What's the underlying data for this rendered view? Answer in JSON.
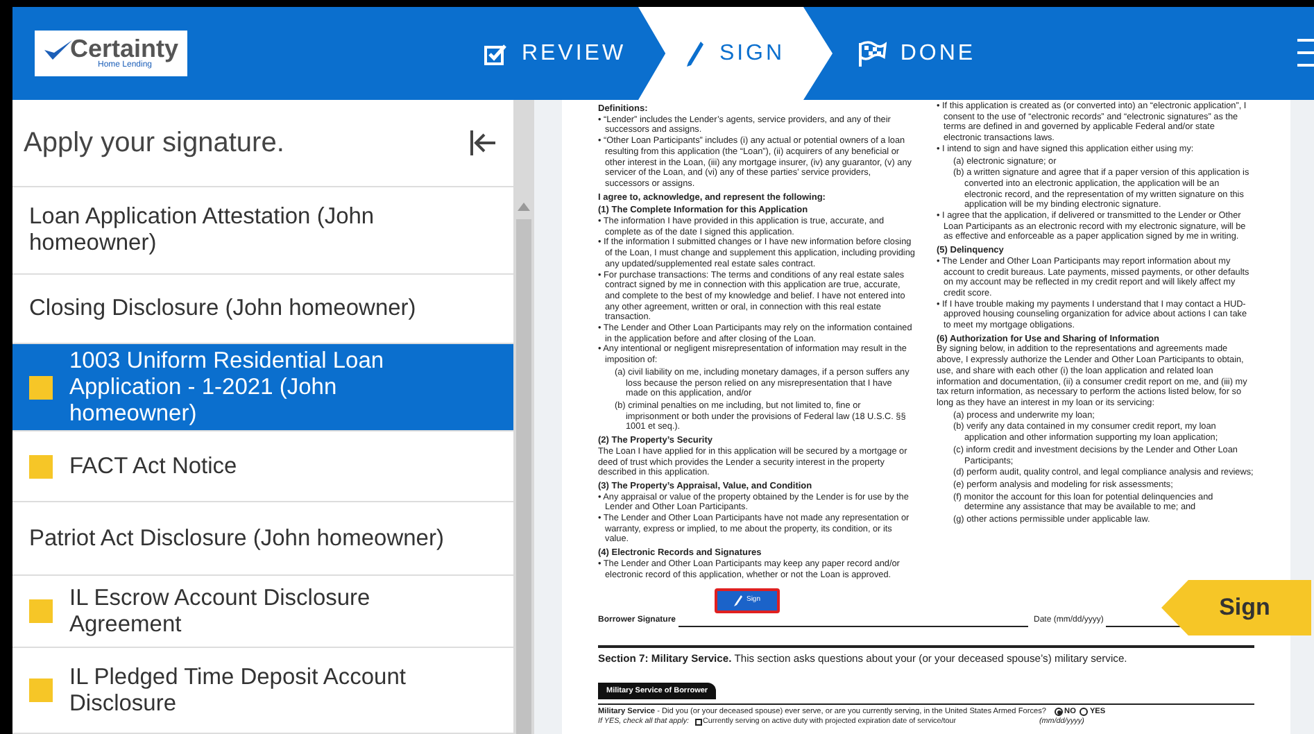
{
  "header": {
    "logo": {
      "name": "Certainty",
      "tagline": "Home Lending"
    },
    "steps": [
      {
        "label": "REVIEW",
        "selected": false
      },
      {
        "label": "SIGN",
        "selected": true
      },
      {
        "label": "DONE",
        "selected": false
      }
    ]
  },
  "sidebar": {
    "title": "Apply your signature.",
    "items": [
      {
        "label": "Loan Application Attestation (John homeowner)",
        "selected": false,
        "needs_signature": false
      },
      {
        "label": "Closing Disclosure (John homeowner)",
        "selected": false,
        "needs_signature": false
      },
      {
        "label": "1003 Uniform Residential Loan Application - 1-2021 (John homeowner)",
        "selected": true,
        "needs_signature": true
      },
      {
        "label": "FACT Act Notice",
        "selected": false,
        "needs_signature": true
      },
      {
        "label": "Patriot Act Disclosure (John homeowner)",
        "selected": false,
        "needs_signature": false
      },
      {
        "label": "IL Escrow Account Disclosure Agreement",
        "selected": false,
        "needs_signature": true
      },
      {
        "label": "IL Pledged Time Deposit Account Disclosure",
        "selected": false,
        "needs_signature": true
      }
    ]
  },
  "document": {
    "left_column": [
      {
        "kind": "heading",
        "text": "Definitions:"
      },
      {
        "kind": "bullet",
        "text": "• “Lender” includes the Lender’s agents, service providers, and any of their successors and assigns."
      },
      {
        "kind": "bullet",
        "text": "• “Other Loan Participants” includes (i) any actual or potential owners of a loan resulting from this application (the “Loan”), (ii) acquirers of any beneficial or other interest in the Loan, (iii) any mortgage insurer, (iv) any guarantor, (v) any servicer of the Loan, and (vi) any of these parties’ service providers, successors or assigns."
      },
      {
        "kind": "heading",
        "text": "I agree to, acknowledge, and represent the following:"
      },
      {
        "kind": "heading",
        "text": "(1) The Complete Information for this Application"
      },
      {
        "kind": "bullet",
        "text": "• The information I have provided in this application is true, accurate, and complete as of the date I signed this application."
      },
      {
        "kind": "bullet",
        "text": "• If the information I submitted changes or I have new information before closing of the Loan, I must change and supplement this application, including providing any updated/supplemented real estate sales contract."
      },
      {
        "kind": "bullet",
        "text": "• For purchase transactions: The terms and conditions of any real estate sales contract signed by me in connection with this application are true, accurate, and complete to the best of my knowledge and belief. I have not entered into any other agreement, written or oral, in connection with this real estate transaction."
      },
      {
        "kind": "bullet",
        "text": "• The Lender and Other Loan Participants may rely on the information contained in the application before and after closing of the Loan."
      },
      {
        "kind": "bullet",
        "text": "• Any intentional or negligent misrepresentation of information may result in the imposition of:"
      },
      {
        "kind": "sub",
        "text": "(a) civil liability on me, including monetary damages, if a person suffers any loss because the person relied on any misrepresentation that I have made on this application, and/or"
      },
      {
        "kind": "sub",
        "text": "(b) criminal penalties on me including, but not limited to, fine or imprisonment or both under the provisions of Federal law (18 U.S.C. §§ 1001 et seq.)."
      },
      {
        "kind": "heading",
        "text": "(2) The Property’s Security"
      },
      {
        "kind": "para",
        "text": "The Loan I have applied for in this application will be secured by a mortgage or deed of trust which provides the Lender a security interest in the property described in this application."
      },
      {
        "kind": "heading",
        "text": "(3) The Property’s Appraisal, Value, and Condition"
      },
      {
        "kind": "bullet",
        "text": "• Any appraisal or value of the property obtained by the Lender is for use by the Lender and Other Loan Participants."
      },
      {
        "kind": "bullet",
        "text": "• The Lender and Other Loan Participants have not made any representation or warranty, express or implied, to me about the property, its condition, or its value."
      },
      {
        "kind": "heading",
        "text": "(4) Electronic Records and Signatures"
      },
      {
        "kind": "bullet",
        "text": "• The Lender and Other Loan Participants may keep any paper record and/or electronic record of this application, whether or not the Loan is approved."
      }
    ],
    "right_column": [
      {
        "kind": "bullet",
        "text": "• If this application is created as (or converted into) an “electronic application”, I consent to the use of “electronic records” and “electronic signatures” as the terms are defined in and governed by applicable Federal and/or state electronic transactions laws."
      },
      {
        "kind": "bullet",
        "text": "• I intend to sign and have signed this application either using my:"
      },
      {
        "kind": "sub",
        "text": "(a) electronic signature; or"
      },
      {
        "kind": "sub",
        "text": "(b) a written signature and agree that if a paper version of this application is converted into an electronic application, the application will be an electronic record, and the representation of my written signature on this application will be my binding electronic signature."
      },
      {
        "kind": "bullet",
        "text": "• I agree that the application, if delivered or transmitted to the Lender or Other Loan Participants as an electronic record with my electronic signature, will be as effective and enforceable as a paper application signed by me in writing."
      },
      {
        "kind": "heading",
        "text": "(5) Delinquency"
      },
      {
        "kind": "bullet",
        "text": "• The Lender and Other Loan Participants may report information about my account to credit bureaus. Late payments, missed payments, or other defaults on my account may be reflected in my credit report and will likely affect my credit score."
      },
      {
        "kind": "bullet",
        "text": "• If I have trouble making my payments I understand that I may contact a HUD-approved housing counseling organization for advice about actions I can take to meet my mortgage obligations."
      },
      {
        "kind": "heading",
        "text": "(6) Authorization for Use and Sharing of Information"
      },
      {
        "kind": "para",
        "text": "By signing below, in addition to the representations and agreements made above, I expressly authorize the Lender and Other Loan Participants to obtain, use, and share with each other (i) the loan application and related loan information and documentation, (ii) a consumer credit report on me, and (iii) my tax return information, as necessary to perform the actions listed below, for so long as they have an interest in my loan or its servicing:"
      },
      {
        "kind": "sub",
        "text": "(a) process and underwrite my loan;"
      },
      {
        "kind": "sub",
        "text": "(b) verify any data contained in my consumer credit report, my loan application and other information supporting my loan application;"
      },
      {
        "kind": "sub",
        "text": "(c) inform credit and investment decisions by the Lender and Other Loan Participants;"
      },
      {
        "kind": "sub",
        "text": "(d) perform audit, quality control, and legal compliance analysis and reviews;"
      },
      {
        "kind": "sub",
        "text": "(e) perform analysis and modeling for risk assessments;"
      },
      {
        "kind": "sub",
        "text": "(f) monitor the account for this loan for potential delinquencies and determine any assistance that may be available to me; and"
      },
      {
        "kind": "sub",
        "text": "(g) other actions permissible under applicable law."
      }
    ],
    "sign_button": "Sign",
    "signature_label": "Borrower Signature",
    "date_label": "Date (mm/dd/yyyy)",
    "section": {
      "title": "**Section 7: Military Service.** This section asks questions about your (or your deceased spouse’s) military service.",
      "tab": "Military Service of Borrower",
      "question": "**Military Service** - Did you (or your deceased spouse) ever serve, or are you currently serving, in the United States Armed Forces?",
      "options": [
        {
          "label": "NO",
          "selected": true
        },
        {
          "label": "YES",
          "selected": false
        }
      ],
      "followup": "If YES, check all that apply:",
      "checkbox": {
        "label": "Currently serving on active duty with projected expiration date of service/tour",
        "checked": false
      },
      "date_hint": "(mm/dd/yyyy)"
    }
  },
  "sign_flag": "Sign"
}
